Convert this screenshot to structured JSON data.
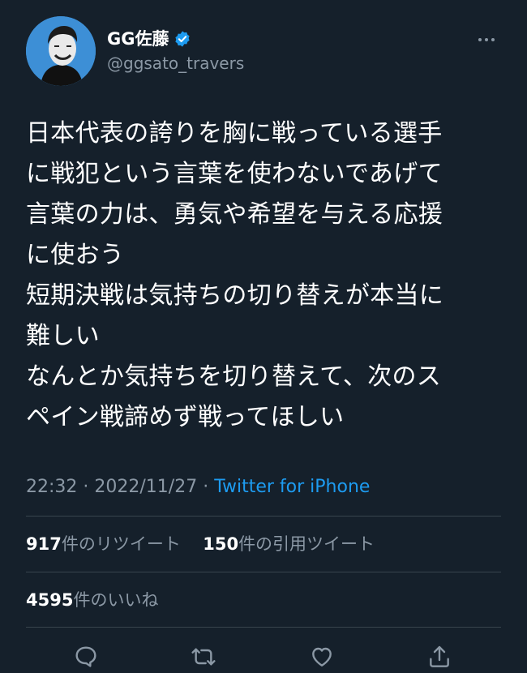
{
  "user": {
    "display_name": "GG佐藤",
    "handle": "@ggsato_travers",
    "verified": true
  },
  "tweet": {
    "lines": [
      "日本代表の誇りを胸に戦っている選手",
      "に戦犯という言葉を使わないであげて",
      "言葉の力は、勇気や希望を与える応援",
      "に使おう",
      "短期決戦は気持ちの切り替えが本当に",
      "難しい",
      "なんとか気持ちを切り替えて、次のス",
      "ペイン戦諦めず戦ってほしい"
    ],
    "time": "22:32",
    "separator1": " · ",
    "date": "2022/11/27",
    "separator2": " · ",
    "source": "Twitter for iPhone"
  },
  "stats": {
    "retweets_count": "917",
    "retweets_label": "件のリツイート",
    "quotes_count": "150",
    "quotes_label": "件の引用ツイート",
    "likes_count": "4595",
    "likes_label": "件のいいね"
  },
  "icons": {
    "more": "more-icon",
    "verified": "verified-badge-icon",
    "reply": "reply-icon",
    "retweet": "retweet-icon",
    "like": "like-icon",
    "share": "share-icon"
  },
  "colors": {
    "background": "#15202b",
    "secondary_text": "#8b98a5",
    "accent": "#1d9bf0",
    "divider": "#38444d"
  }
}
